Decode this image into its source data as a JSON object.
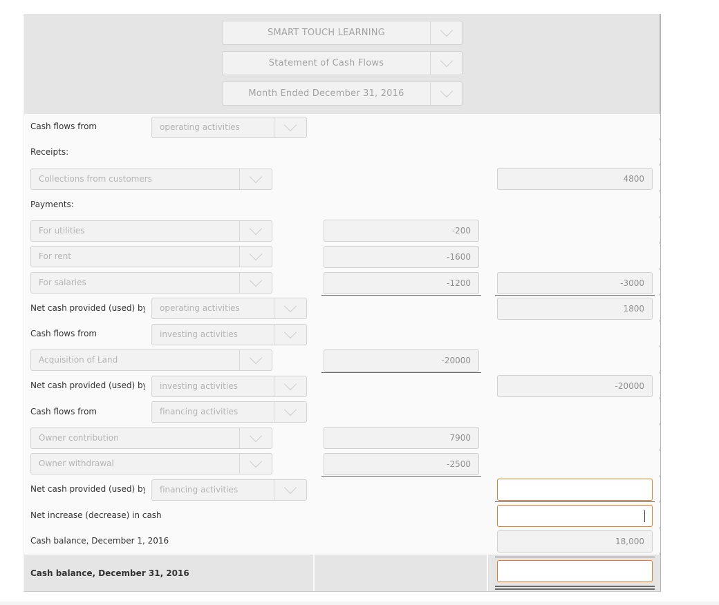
{
  "header": {
    "company": "SMART TOUCH LEARNING",
    "statement": "Statement of Cash Flows",
    "period": "Month Ended December 31, 2016"
  },
  "rows": {
    "op_heading": {
      "label": "Cash flows from",
      "select": "operating activities"
    },
    "receipts": {
      "label": "Receipts:"
    },
    "collections": {
      "select": "Collections from customers",
      "col3": "4800"
    },
    "payments": {
      "label": "Payments:"
    },
    "utilities": {
      "select": "For utilities",
      "col2": "-200"
    },
    "rent": {
      "select": "For rent",
      "col2": "-1600"
    },
    "salaries": {
      "select": "For salaries",
      "col2": "-1200",
      "col3": "-3000"
    },
    "op_net": {
      "label": "Net cash provided (used) by",
      "select": "operating activities",
      "col3": "1800"
    },
    "inv_heading": {
      "label": "Cash flows from",
      "select": "investing activities"
    },
    "land": {
      "select": "Acquisition of Land",
      "col2": "-20000"
    },
    "inv_net": {
      "label": "Net cash provided (used) by",
      "select": "investing activities",
      "col3": "-20000"
    },
    "fin_heading": {
      "label": "Cash flows from",
      "select": "financing activities"
    },
    "contribution": {
      "select": "Owner contribution",
      "col2": "7900"
    },
    "withdrawal": {
      "select": "Owner withdrawal",
      "col2": "-2500"
    },
    "fin_net": {
      "label": "Net cash provided (used) by",
      "select": "financing activities",
      "col3": ""
    },
    "net_increase": {
      "label": "Net increase (decrease) in cash",
      "col3": ""
    },
    "cash_begin": {
      "label": "Cash balance, December 1, 2016",
      "col3": "18,000"
    },
    "cash_end": {
      "label": "Cash balance, December 31, 2016",
      "col3": ""
    }
  },
  "colors": {
    "active_input_border": "#e07c24",
    "header_bg": "#e5e5e5"
  }
}
